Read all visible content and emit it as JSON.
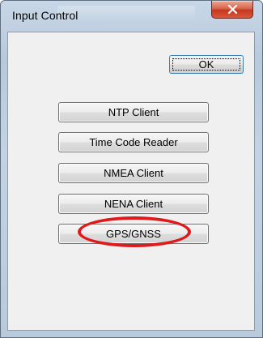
{
  "window": {
    "title": "Input Control"
  },
  "dialog": {
    "ok_label": "OK",
    "buttons": [
      {
        "label": "NTP Client"
      },
      {
        "label": "Time Code Reader"
      },
      {
        "label": "NMEA Client"
      },
      {
        "label": "NENA Client"
      },
      {
        "label": "GPS/GNSS"
      }
    ]
  },
  "icons": {
    "close": "close-icon"
  },
  "colors": {
    "annotation": "#e0191b",
    "close_button": "#c7371d"
  }
}
